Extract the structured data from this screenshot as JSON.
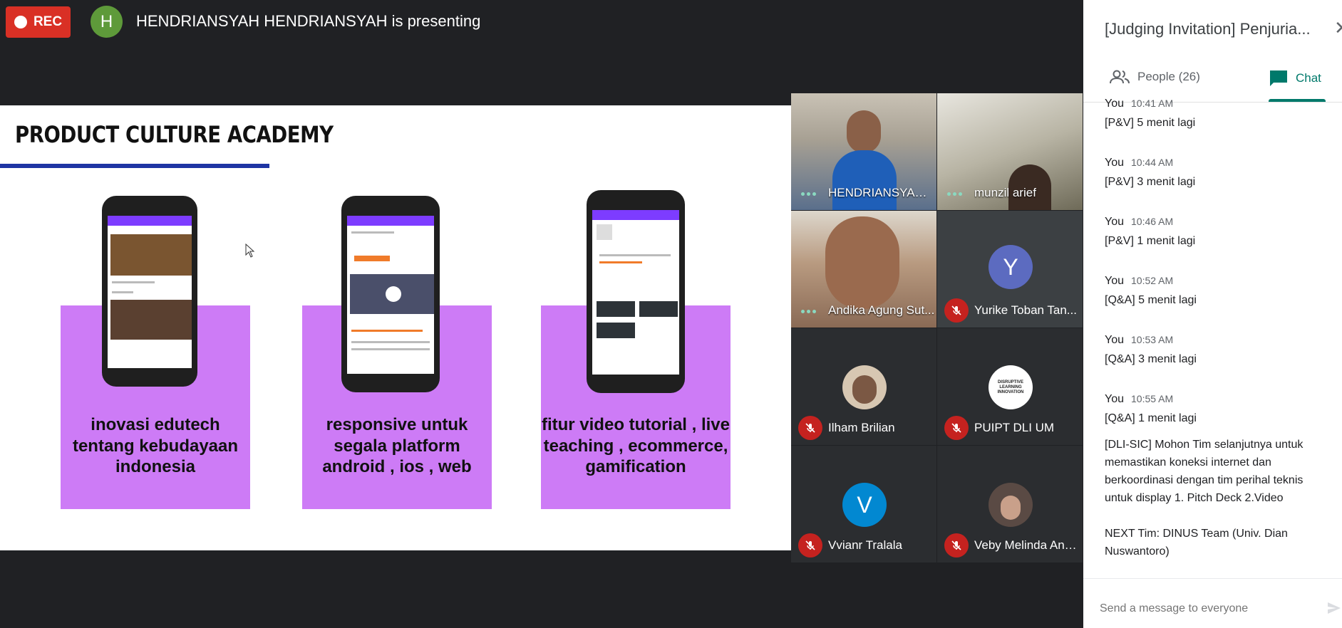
{
  "recording": {
    "label": "REC"
  },
  "presenter": {
    "initial": "H",
    "text": "HENDRIANSYAH HENDRIANSYAH is presenting"
  },
  "slide": {
    "title": "PRODUCT CULTURE ACADEMY",
    "cards": [
      {
        "text": "inovasi edutech tentang kebudayaan indonesia"
      },
      {
        "text": "responsive untuk segala platform android , ios , web"
      },
      {
        "text": "fitur video tutorial , live teaching , ecommerce, gamification"
      }
    ]
  },
  "participants": [
    {
      "name": "HENDRIANSYAH ...",
      "type": "video",
      "speaking": true
    },
    {
      "name": "munzil arief",
      "type": "video",
      "speaking": true
    },
    {
      "name": "Andika Agung Sut...",
      "type": "video",
      "speaking": true
    },
    {
      "name": "Yurike Toban Tan...",
      "type": "avatar",
      "initial": "Y",
      "color": "#5c6bc0",
      "muted": true
    },
    {
      "name": "Ilham Brilian",
      "type": "photo",
      "muted": true
    },
    {
      "name": "PUIPT DLI UM",
      "type": "logo",
      "muted": true,
      "logo_text": "DISRUPTIVE LEARNING INNOVATION"
    },
    {
      "name": "Vvianr Tralala",
      "type": "avatar",
      "initial": "V",
      "color": "#0288d1",
      "muted": true
    },
    {
      "name": "Veby Melinda Ann...",
      "type": "photo",
      "muted": true
    }
  ],
  "panel": {
    "title": "[Judging Invitation] Penjuria...",
    "tabs": {
      "people": "People (26)",
      "chat": "Chat"
    },
    "messages": [
      {
        "sender": "You",
        "time": "10:41 AM",
        "text": "[P&V] 5 menit lagi"
      },
      {
        "sender": "You",
        "time": "10:44 AM",
        "text": "[P&V] 3 menit lagi"
      },
      {
        "sender": "You",
        "time": "10:46 AM",
        "text": "[P&V]  1 menit lagi"
      },
      {
        "sender": "You",
        "time": "10:52 AM",
        "text": "[Q&A] 5 menit lagi"
      },
      {
        "sender": "You",
        "time": "10:53 AM",
        "text": "[Q&A] 3 menit lagi"
      },
      {
        "sender": "You",
        "time": "10:55 AM",
        "text": "[Q&A] 1 menit lagi",
        "extra": [
          "[DLI-SIC] Mohon Tim selanjutnya untuk memastikan koneksi internet dan berkoordinasi dengan tim perihal teknis untuk display 1. Pitch Deck 2.Video",
          "NEXT Tim: DINUS Team (Univ. Dian Nuswantoro)"
        ]
      }
    ],
    "compose_placeholder": "Send a message to everyone"
  },
  "colors": {
    "rec": "#d93025",
    "accent": "#00796b",
    "card": "#cd7bf6",
    "underline": "#1f35a3",
    "muted": "#c5221f"
  },
  "icons": [
    "record-dot-icon",
    "people-icon",
    "chat-icon",
    "close-icon",
    "mic-off-icon",
    "send-icon",
    "play-icon",
    "cursor-icon"
  ]
}
